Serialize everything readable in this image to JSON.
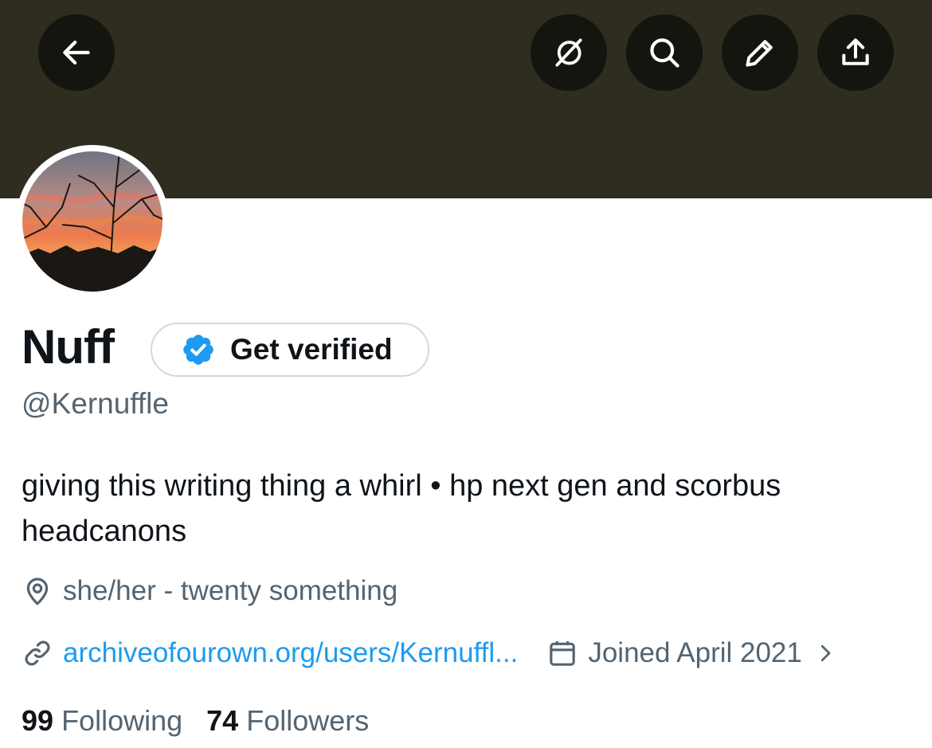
{
  "profile": {
    "display_name": "Nuff",
    "handle": "@Kernuffle",
    "bio": "giving this writing thing a whirl • hp next gen and scorbus headcanons",
    "location": "she/her - twenty something",
    "link": "archiveofourown.org/users/Kernuffl...",
    "joined": "Joined April 2021"
  },
  "verify": {
    "label": "Get verified"
  },
  "stats": {
    "following_count": "99",
    "following_label": "Following",
    "followers_count": "74",
    "followers_label": "Followers"
  },
  "header_icons": [
    "back-arrow-icon",
    "grok-icon",
    "search-icon",
    "pencil-icon",
    "share-icon"
  ],
  "colors": {
    "banner": "#2e2d1f",
    "icon_button_bg": "#151510",
    "link": "#1d9bf0",
    "verified_badge": "#1d9bf0",
    "secondary_text": "#536471",
    "primary_text": "#0f1419"
  }
}
